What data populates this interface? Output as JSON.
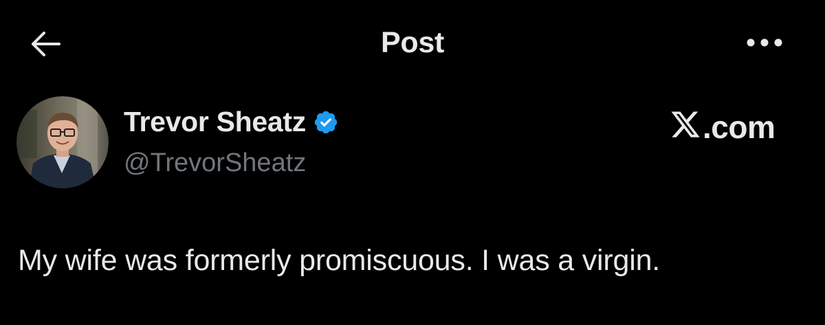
{
  "header": {
    "title": "Post",
    "back_icon": "arrow-left-icon",
    "more_icon": "more-horizontal-icon"
  },
  "author": {
    "display_name": "Trevor Sheatz",
    "handle": "@TrevorSheatz",
    "verified": true,
    "verified_icon": "verified-badge-icon",
    "verified_color": "#1d9bf0"
  },
  "watermark": {
    "text": ".com",
    "logo_icon": "x-logo-icon"
  },
  "post": {
    "text": "My wife was formerly promiscuous. I was a virgin."
  },
  "colors": {
    "background": "#000000",
    "primary_text": "#e7e9ea",
    "secondary_text": "#71767b",
    "accent": "#1d9bf0"
  }
}
